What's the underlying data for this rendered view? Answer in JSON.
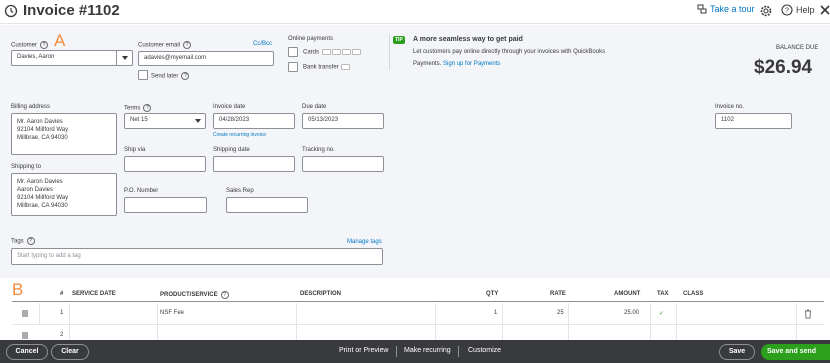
{
  "header": {
    "title": "Invoice #1102",
    "take_tour": "Take a tour",
    "help": "Help"
  },
  "customer": {
    "label": "Customer",
    "value": "Davies, Aaron",
    "marker": "A"
  },
  "email": {
    "label": "Customer email",
    "value": "adavies@myemail.com",
    "cc_bcc": "Cc/Bcc",
    "send_later": "Send later"
  },
  "online_payments": {
    "label": "Online payments",
    "cards": "Cards",
    "bank_transfer": "Bank transfer",
    "tip_badge": "TIP",
    "tip_title": "A more seamless way to get paid",
    "tip_text": "Let customers pay online directly through your invoices with QuickBooks",
    "tip_text2": "Payments.",
    "tip_link": "Sign up for Payments"
  },
  "balance": {
    "label": "BALANCE DUE",
    "amount": "$26.94"
  },
  "billing": {
    "label": "Billing address",
    "value": "Mr. Aaron Davies\n92104 Millford Way\nMillbrae, CA 94030"
  },
  "shipping_to": {
    "label": "Shipping to",
    "value": "Mr. Aaron Davies\nAaron Davies\n92104 Millford Way\nMillbrae, CA 94030"
  },
  "terms": {
    "label": "Terms",
    "value": "Net 15"
  },
  "invoice_date": {
    "label": "Invoice date",
    "value": "04/28/2023",
    "recurring_link": "Create recurring invoice"
  },
  "due_date": {
    "label": "Due date",
    "value": "05/13/2023"
  },
  "invoice_no": {
    "label": "Invoice no.",
    "value": "1102"
  },
  "ship_via": {
    "label": "Ship via",
    "value": ""
  },
  "shipping_date": {
    "label": "Shipping date",
    "value": ""
  },
  "tracking_no": {
    "label": "Tracking no.",
    "value": ""
  },
  "po_number": {
    "label": "P.O. Number",
    "value": ""
  },
  "sales_rep": {
    "label": "Sales Rep",
    "value": ""
  },
  "tags": {
    "label": "Tags",
    "manage": "Manage tags",
    "placeholder": "Start typing to add a tag"
  },
  "table": {
    "marker": "B",
    "headers": {
      "num": "#",
      "service_date": "SERVICE DATE",
      "product": "PRODUCT/SERVICE",
      "description": "DESCRIPTION",
      "qty": "QTY",
      "rate": "RATE",
      "amount": "AMOUNT",
      "tax": "TAX",
      "class": "CLASS"
    },
    "rows": [
      {
        "num": "1",
        "service_date": "",
        "product": "NSF Fee",
        "description": "",
        "qty": "1",
        "rate": "25",
        "amount": "25.00",
        "tax": "✓",
        "class": ""
      },
      {
        "num": "2",
        "service_date": "",
        "product": "",
        "description": "",
        "qty": "",
        "rate": "",
        "amount": "",
        "tax": "",
        "class": ""
      }
    ]
  },
  "footer": {
    "cancel": "Cancel",
    "clear": "Clear",
    "print_preview": "Print or Preview",
    "make_recurring": "Make recurring",
    "customize": "Customize",
    "save": "Save",
    "save_and_send": "Save and send"
  },
  "colors": {
    "accent_green": "#2ca01c",
    "link_blue": "#0077c5",
    "marker_orange": "#f58b3a",
    "footer_bg": "#393a3d"
  },
  "icons": [
    "history-icon",
    "take-tour-icon",
    "gear-icon",
    "help-icon",
    "close-icon",
    "trash-icon",
    "drag-handle-icon",
    "question-icon"
  ]
}
